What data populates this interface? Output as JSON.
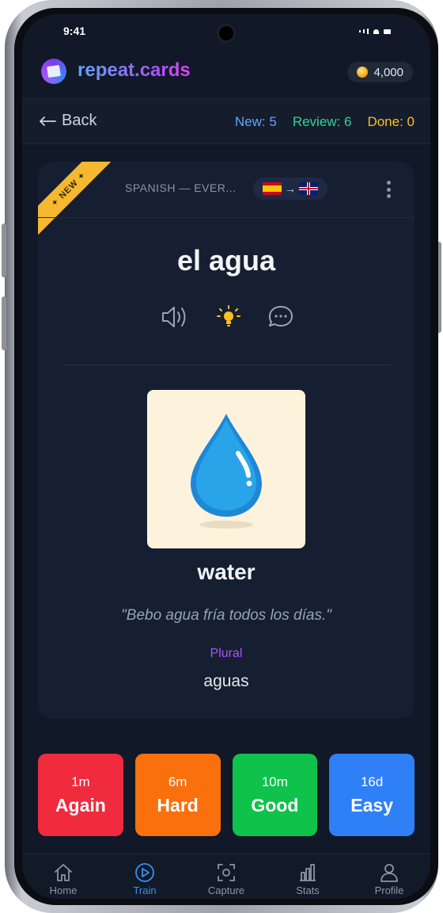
{
  "status_bar": {
    "time": "9:41"
  },
  "header": {
    "brand": "repeat.cards",
    "coins": "4,000"
  },
  "nav": {
    "back_label": "Back",
    "new": "New: 5",
    "review": "Review: 6",
    "done": "Done: 0"
  },
  "card": {
    "badge": "NEW",
    "deck": "SPANISH — EVER...",
    "word": "el agua",
    "translation": "water",
    "example": "\"Bebo agua fría todos los días.\"",
    "plural_label": "Plural",
    "plural_value": "aguas",
    "icons": [
      "speaker-icon",
      "lightbulb-icon",
      "chat-icon"
    ]
  },
  "answers": [
    {
      "interval": "1m",
      "label": "Again",
      "color": "#ef2b3d"
    },
    {
      "interval": "6m",
      "label": "Hard",
      "color": "#f9700c"
    },
    {
      "interval": "10m",
      "label": "Good",
      "color": "#0fc24c"
    },
    {
      "interval": "16d",
      "label": "Easy",
      "color": "#2f80f7"
    }
  ],
  "tabs": [
    {
      "label": "Home",
      "icon": "home-icon"
    },
    {
      "label": "Train",
      "icon": "play-circle-icon",
      "active": true
    },
    {
      "label": "Capture",
      "icon": "capture-icon"
    },
    {
      "label": "Stats",
      "icon": "stats-icon"
    },
    {
      "label": "Profile",
      "icon": "profile-icon"
    }
  ],
  "colors": {
    "accent": "#3b8ff0",
    "background": "#111827",
    "card": "#161f31",
    "badge": "#f5b82e"
  }
}
